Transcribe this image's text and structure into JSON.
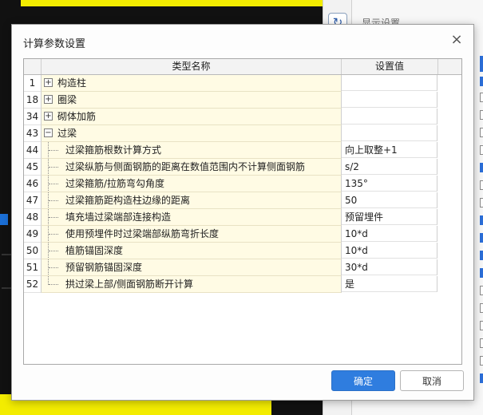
{
  "dialog": {
    "title": "计算参数设置",
    "ok_label": "确定",
    "cancel_label": "取消",
    "close_icon": "×"
  },
  "grid": {
    "columns": {
      "name": "类型名称",
      "value": "设置值"
    },
    "groups": [
      {
        "num": "1",
        "label": "构造柱",
        "expander": "+"
      },
      {
        "num": "18",
        "label": "圈梁",
        "expander": "+"
      },
      {
        "num": "34",
        "label": "砌体加筋",
        "expander": "+"
      },
      {
        "num": "43",
        "label": "过梁",
        "expander": "−"
      }
    ],
    "rows": [
      {
        "num": "44",
        "name": "过梁箍筋根数计算方式",
        "value": "向上取整+1"
      },
      {
        "num": "45",
        "name": "过梁纵筋与侧面钢筋的距离在数值范围内不计算侧面钢筋",
        "value": "s/2"
      },
      {
        "num": "46",
        "name": "过梁箍筋/拉筋弯勾角度",
        "value": "135°"
      },
      {
        "num": "47",
        "name": "过梁箍筋距构造柱边缘的距离",
        "value": "50"
      },
      {
        "num": "48",
        "name": "填充墙过梁端部连接构造",
        "value": "预留埋件"
      },
      {
        "num": "49",
        "name": "使用预埋件时过梁端部纵筋弯折长度",
        "value": "10*d"
      },
      {
        "num": "50",
        "name": "植筋锚固深度",
        "value": "10*d"
      },
      {
        "num": "51",
        "name": "预留钢筋锚固深度",
        "value": "30*d"
      },
      {
        "num": "52",
        "name": "拱过梁上部/侧面钢筋断开计算",
        "value": "是"
      }
    ]
  },
  "background": {
    "panel_title": "显示设置",
    "refresh_icon": "↻"
  },
  "colors": {
    "accent": "#2f7ddf",
    "name_cell": "#fffbe4",
    "highlight": "#f3ec00"
  }
}
